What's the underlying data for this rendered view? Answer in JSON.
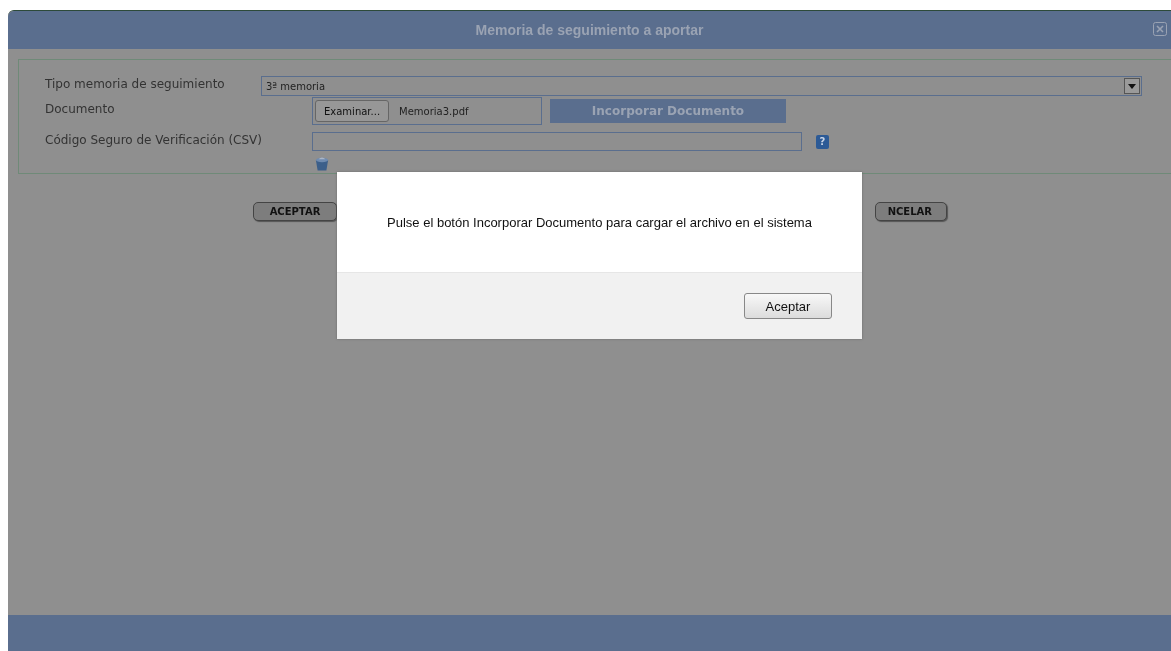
{
  "window": {
    "title": "Memoria de seguimiento a aportar"
  },
  "form": {
    "tipo_label": "Tipo memoria de seguimiento",
    "tipo_value": "3ª memoria",
    "documento_label": "Documento",
    "browse_button": "Examinar...",
    "file_name": "Memoria3.pdf",
    "incorporar_button": "Incorporar Documento",
    "csv_label": "Código Seguro de Verificación (CSV)",
    "help": "?"
  },
  "buttons": {
    "accept": "ACEPTAR",
    "cancel": "NCELAR"
  },
  "alert": {
    "message": "Pulse el botón Incorporar Documento para cargar el archivo en el sistema",
    "ok_button": "Aceptar"
  }
}
